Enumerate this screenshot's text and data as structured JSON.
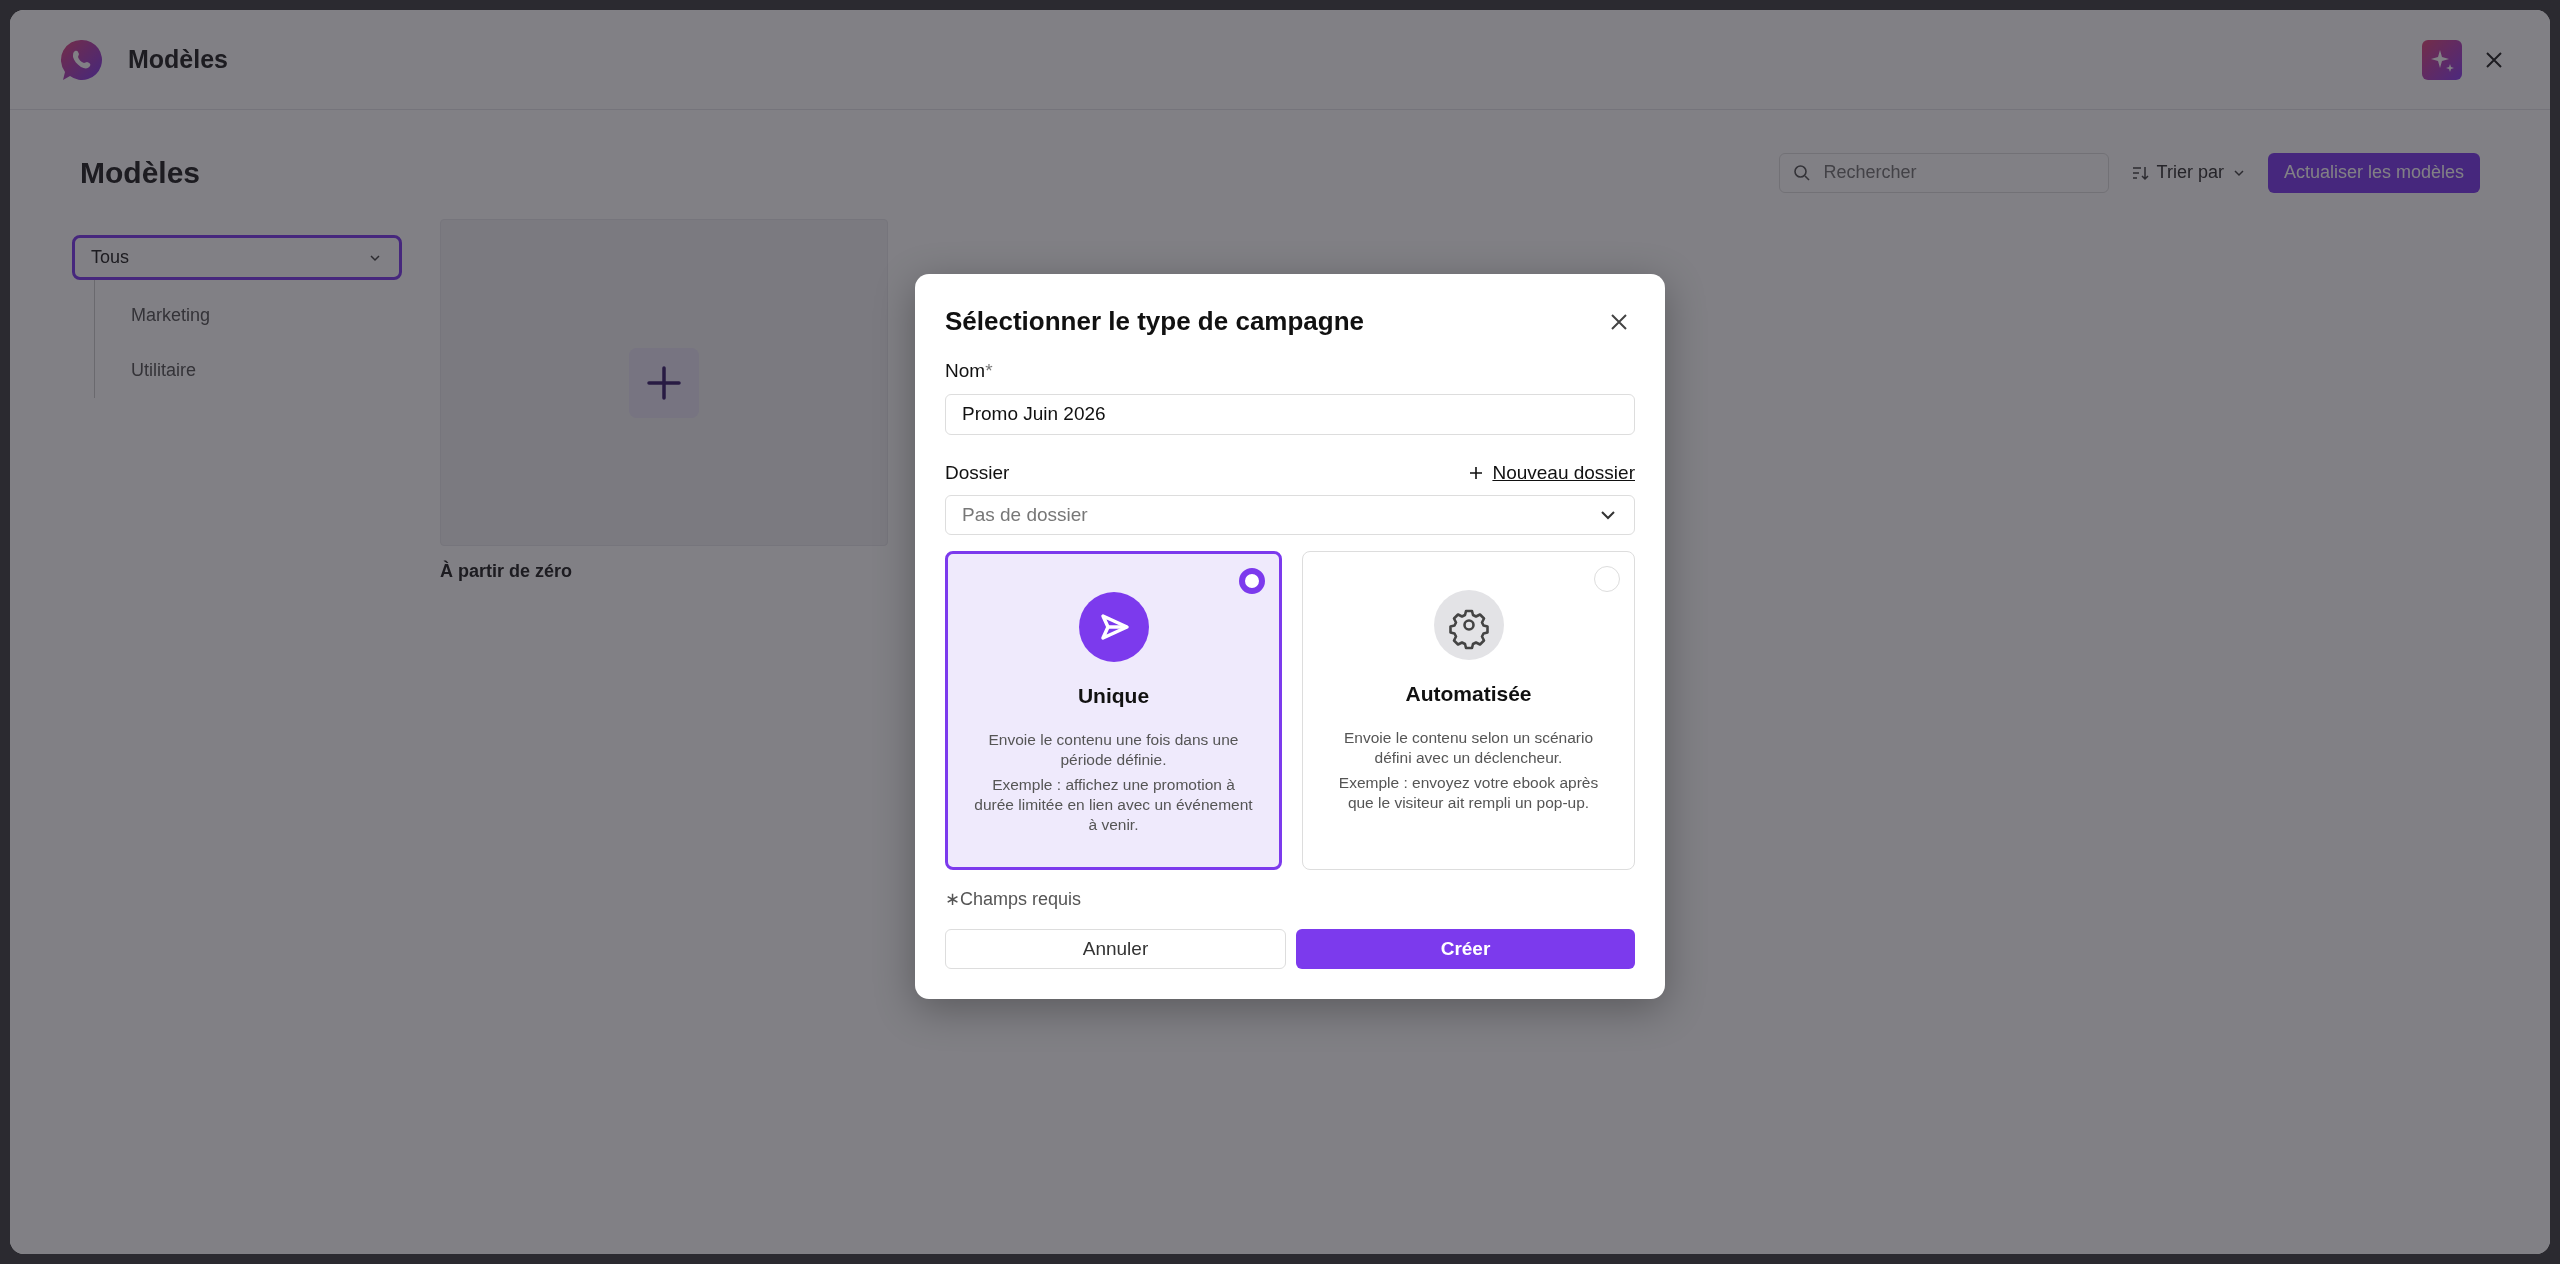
{
  "window": {
    "title": "Modèles"
  },
  "page": {
    "heading": "Modèles",
    "search": {
      "placeholder": "Rechercher"
    },
    "sort_label": "Trier par",
    "refresh_button": "Actualiser les modèles"
  },
  "sidebar": {
    "filter": "Tous",
    "items": [
      {
        "label": "Marketing"
      },
      {
        "label": "Utilitaire"
      }
    ]
  },
  "templates": [
    {
      "label": "À partir de zéro"
    }
  ],
  "dialog": {
    "title": "Sélectionner le type de campagne",
    "name_label": "Nom",
    "name_required_mark": "*",
    "name_value": "Promo Juin 2026",
    "folder_label": "Dossier",
    "new_folder_link": "Nouveau dossier",
    "folder_placeholder": "Pas de dossier",
    "options": [
      {
        "kind": "send",
        "title": "Unique",
        "description": "Envoie le contenu une fois dans une période définie.",
        "example": "Exemple : affichez une promotion à durée limitée en lien avec un événement à venir.",
        "selected": true
      },
      {
        "kind": "gear",
        "title": "Automatisée",
        "description": "Envoie le contenu selon un scénario défini avec un déclencheur.",
        "example": "Exemple : envoyez votre ebook après que le visiteur ait rempli un pop-up.",
        "selected": false
      }
    ],
    "required_note": "∗Champs requis",
    "cancel_button": "Annuler",
    "create_button": "Créer"
  }
}
